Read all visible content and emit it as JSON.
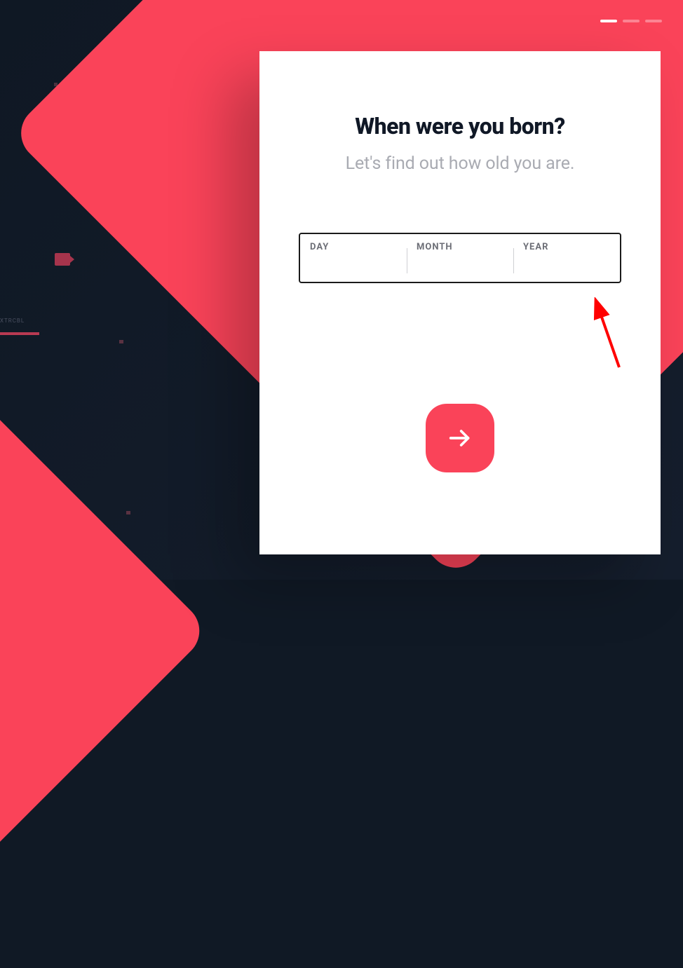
{
  "progress": {
    "total": 3,
    "active_index": 0
  },
  "card": {
    "title": "When were you born?",
    "subtitle": "Let's find out how old you are."
  },
  "dob": {
    "day": {
      "label": "DAY",
      "value": ""
    },
    "month": {
      "label": "MONTH",
      "value": ""
    },
    "year": {
      "label": "YEAR",
      "value": ""
    }
  },
  "colors": {
    "accent": "#fa4359",
    "dark": "#101925"
  }
}
